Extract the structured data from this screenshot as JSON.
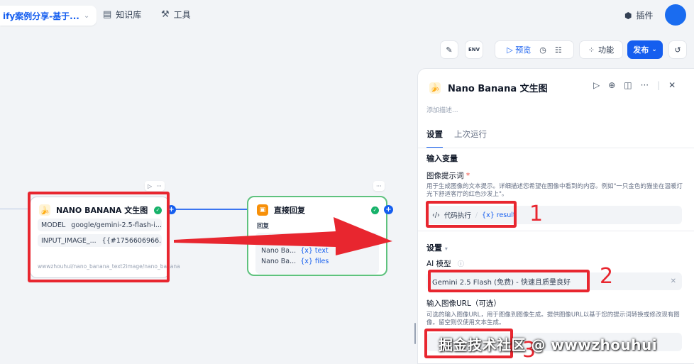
{
  "topbar": {
    "app_title": "ify案例分享-基于...",
    "nav_knowledge": "知识库",
    "nav_tools": "工具",
    "plugins": "插件"
  },
  "toolbar": {
    "env_label": "ENV",
    "preview": "预览",
    "features": "功能",
    "publish": "发布"
  },
  "canvas": {
    "node1": {
      "title": "NANO BANANA 文生图",
      "rows": [
        {
          "key": "MODEL",
          "value": "google/gemini-2.5-flash-i..."
        },
        {
          "key": "INPUT_IMAGE_...",
          "value": "{{#1756606966..."
        }
      ],
      "footer": "wwwzhouhui/nano_banana_text2image/nano_banana"
    },
    "node2": {
      "title": "直接回复",
      "label": "回复",
      "lines": [
        {
          "name": "Nano Ba...",
          "var": "{x} text"
        },
        {
          "name": "Nano Ba...",
          "var": "{x} files"
        }
      ]
    }
  },
  "panel": {
    "title": "Nano Banana 文生图",
    "description_placeholder": "添加描述...",
    "tabs": [
      "设置",
      "上次运行"
    ],
    "input_vars_title": "输入变量",
    "prompt_label": "图像提示词",
    "prompt_required": "*",
    "prompt_help": "用于生成图像的文本提示。详细描述您希望在图像中看到的内容。例如\"一只金色的猫坐在温暖灯光下舒适客厅的红色沙发上\"。",
    "prompt_chip_node": "代码执行",
    "prompt_chip_var": "{x} result",
    "settings_title": "设置",
    "ai_model_label": "AI 模型",
    "ai_model_value": "Gemini 2.5 Flash (免费) - 快速且质量良好",
    "image_url_label": "输入图像URL（可选）",
    "image_url_help": "可选的输入图像URL，用于图像到图像生成。提供图像URL以基于您的提示词转换或修改现有图像。留空则仅使用文本生成。"
  },
  "annotations": {
    "one": "1",
    "two": "2",
    "three": "3"
  },
  "watermark": "掘金技术社区 @ wwwzhouhui",
  "colors": {
    "accent": "#155eef",
    "highlight": "#e8262f",
    "success": "#17b26a"
  }
}
